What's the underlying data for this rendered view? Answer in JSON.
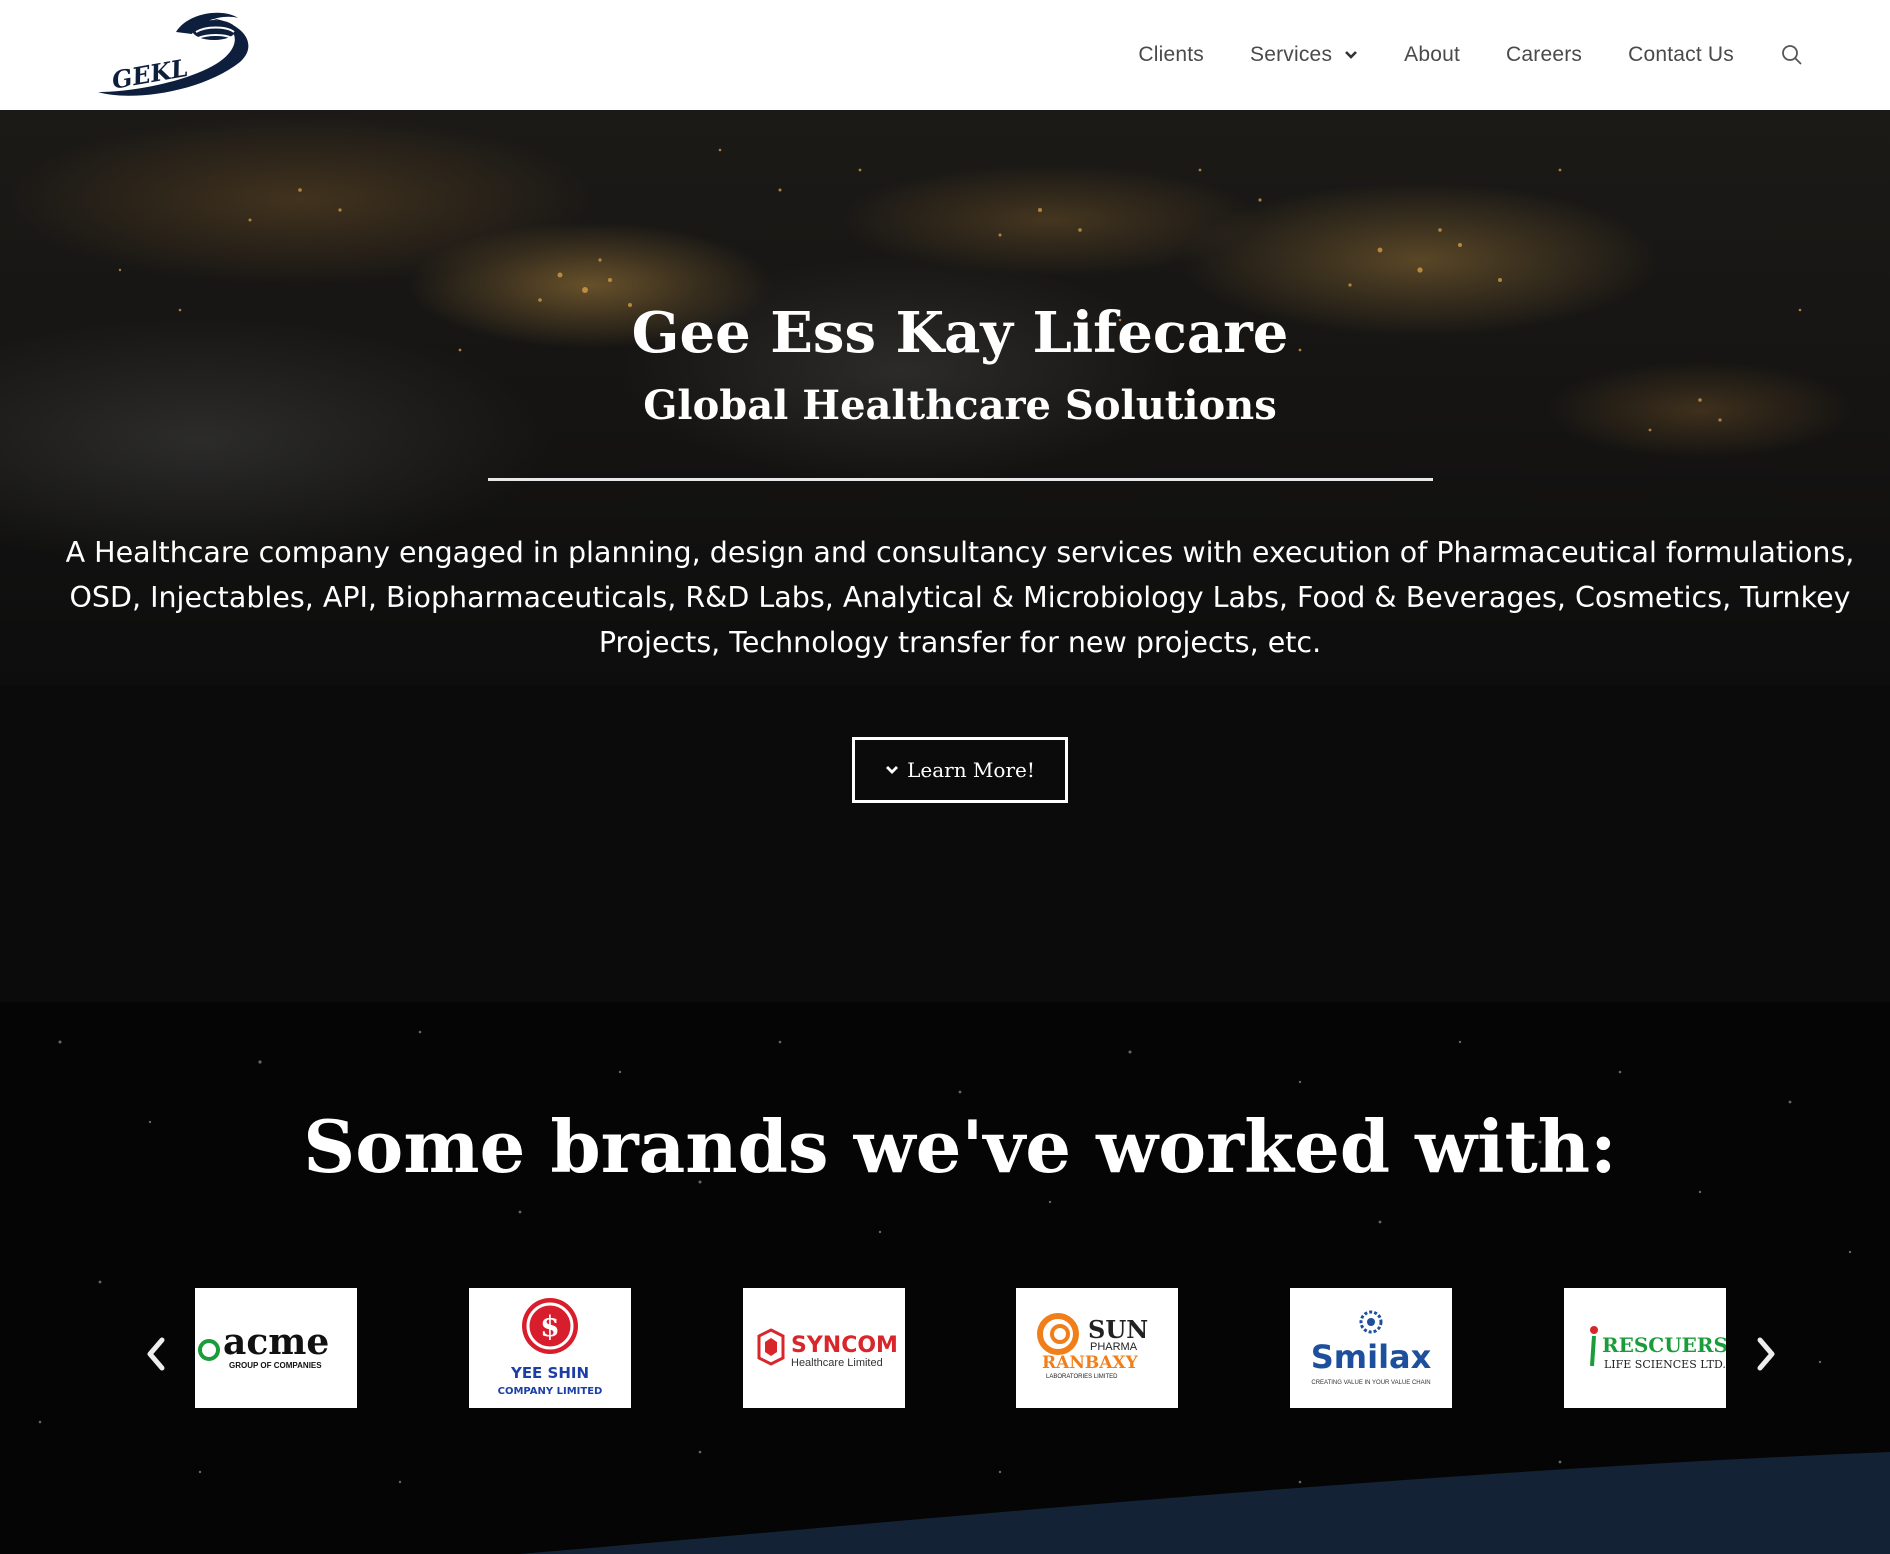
{
  "nav": {
    "logo_text": "GEKL",
    "items": [
      {
        "label": "Clients"
      },
      {
        "label": "Services"
      },
      {
        "label": "About"
      },
      {
        "label": "Careers"
      },
      {
        "label": "Contact Us"
      }
    ]
  },
  "hero": {
    "title": "Gee Ess Kay Lifecare",
    "subtitle": "Global Healthcare Solutions",
    "description": "A Healthcare company engaged in planning, design and consultancy services with execution of Pharmaceutical formulations, OSD, Injectables, API, Biopharmaceuticals, R&D Labs, Analytical & Microbiology Labs, Food & Beverages, Cosmetics, Turnkey Projects, Technology transfer for new projects, etc.",
    "button_label": "Learn More!"
  },
  "brands": {
    "title": "Some brands we've worked with:",
    "logos": [
      {
        "name": "acme",
        "subtext": "GROUP OF COMPANIES"
      },
      {
        "name": "YEE SHIN",
        "subtext": "COMPANY LIMITED"
      },
      {
        "name": "SYNCOM",
        "subtext": "Healthcare Limited"
      },
      {
        "name": "SUN",
        "subtext": "PHARMA",
        "extra": "RANBAXY",
        "extra_sub": "LABORATORIES LIMITED"
      },
      {
        "name": "Smilax",
        "subtext": "CREATING VALUE IN YOUR VALUE CHAIN"
      },
      {
        "name": "RESCUERS",
        "subtext": "LIFE SCIENCES LTD."
      }
    ]
  },
  "colors": {
    "nav_text": "#4a4a4a",
    "logo_navy": "#0e1f3d",
    "acme_green": "#1a9c3a",
    "yeeshin_red": "#d81e2c",
    "yeeshin_blue": "#1c3fa6",
    "syncom_red": "#d8262b",
    "sun_orange": "#f07f1a",
    "smilax_blue": "#1d4f9c"
  },
  "icons": {
    "search": "search-icon",
    "services_caret": "chevron-down-icon",
    "carousel_prev": "chevron-left-icon",
    "carousel_next": "chevron-right-icon",
    "button_caret": "chevron-down-icon"
  }
}
